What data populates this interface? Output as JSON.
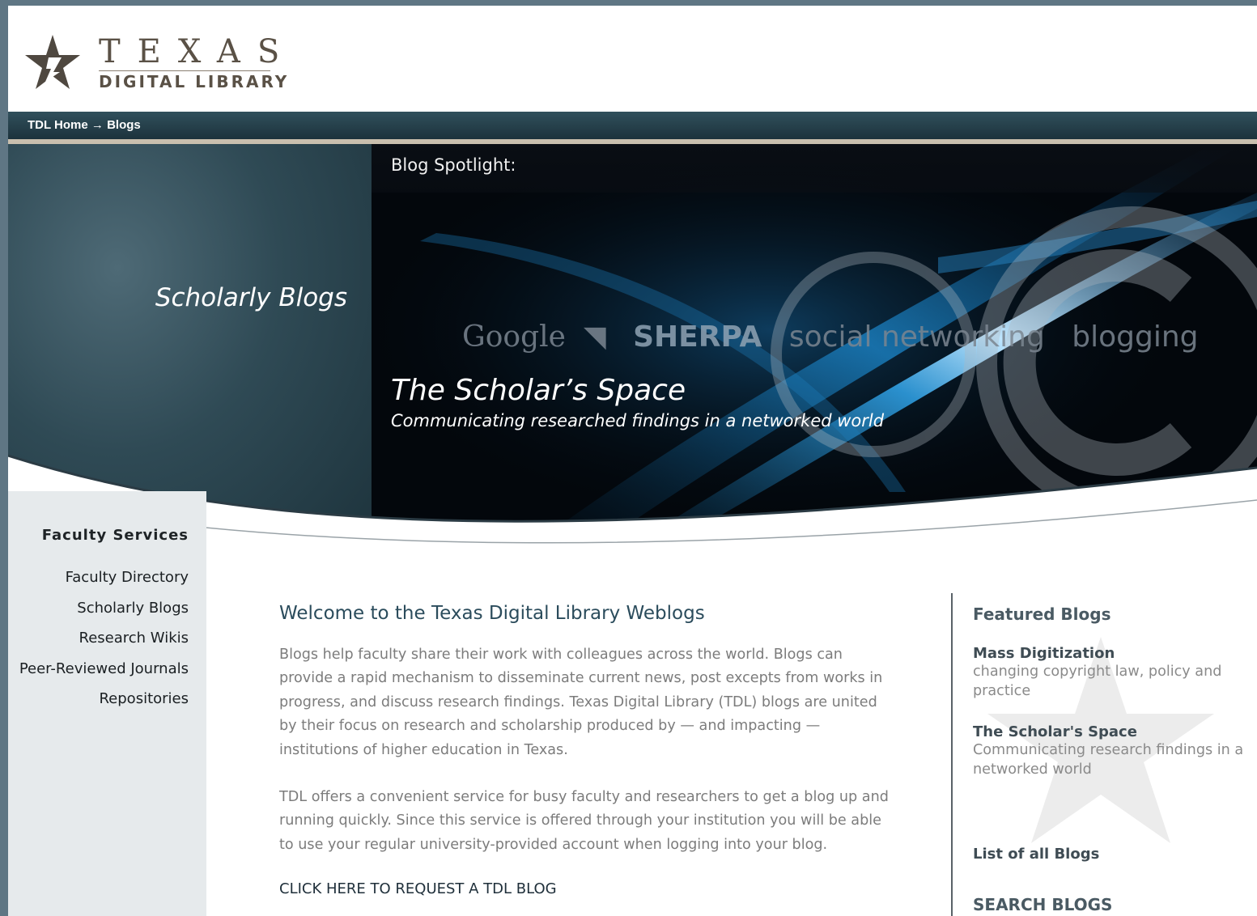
{
  "header": {
    "logo_line1": "TEXAS",
    "logo_line2": "DIGITAL LIBRARY"
  },
  "breadcrumb": {
    "home": "TDL Home",
    "separator": "→",
    "current": "Blogs"
  },
  "banner": {
    "section_title": "Scholarly Blogs",
    "spotlight_label": "Blog Spotlight:",
    "background_words": [
      "Google",
      "SHERPA",
      "social networking",
      "blogging"
    ],
    "spotlight_blog_name": "The Scholar’s Space",
    "spotlight_blog_tagline": "Communicating researched findings in a networked world"
  },
  "sidebar": {
    "title": "Faculty Services",
    "items": [
      {
        "label": "Faculty Directory"
      },
      {
        "label": "Scholarly Blogs"
      },
      {
        "label": "Research Wikis"
      },
      {
        "label": "Peer-Reviewed Journals"
      },
      {
        "label": "Repositories"
      }
    ]
  },
  "main": {
    "title": "Welcome to the Texas Digital Library Weblogs",
    "paragraph1": "Blogs help faculty share their work with colleagues across the world. Blogs can provide a rapid mechanism to disseminate current news, post excepts from works in progress, and discuss research findings. Texas Digital Library (TDL) blogs are united by their focus on research and scholarship produced by — and impacting — institutions of higher education in Texas.",
    "paragraph2": "TDL offers a convenient service for busy faculty and researchers to get a blog up and running quickly. Since this service is offered through your institution you will be able to use your regular university-provided account when logging into your blog.",
    "request_link": "CLICK HERE TO REQUEST A TDL BLOG"
  },
  "featured": {
    "title": "Featured Blogs",
    "items": [
      {
        "name": "Mass Digitization",
        "description": "changing copyright law, policy and practice"
      },
      {
        "name": "The Scholar's Space",
        "description": "Communicating research findings in a networked world"
      }
    ],
    "list_all": "List of all Blogs",
    "search_title": "SEARCH BLOGS"
  },
  "colors": {
    "outer_background": "#5f7684",
    "nav_bar": "#233b46",
    "sidebar_background": "#e6eaec",
    "heading_blue": "#2b4c5c"
  },
  "icons": [
    "star-logo-icon",
    "rss-icon",
    "copyright-icon"
  ]
}
